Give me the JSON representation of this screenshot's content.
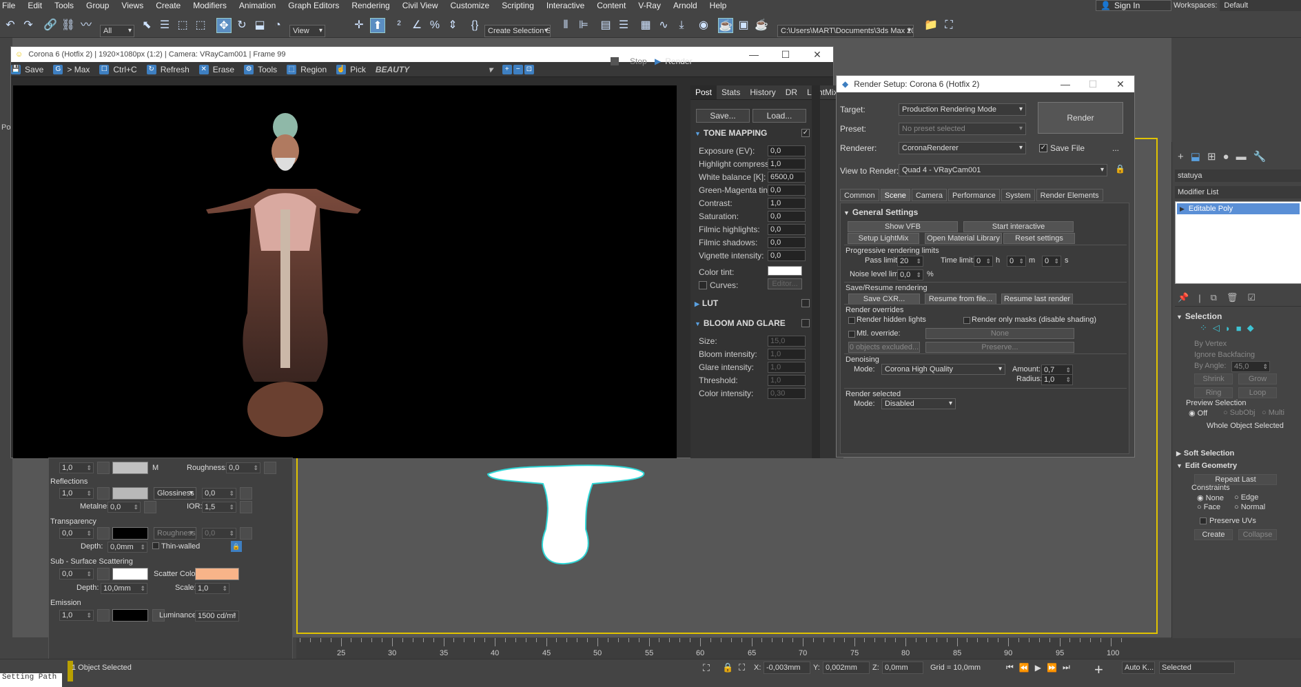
{
  "menubar": {
    "items": [
      "File",
      "Edit",
      "Tools",
      "Group",
      "Views",
      "Create",
      "Modifiers",
      "Animation",
      "Graph Editors",
      "Rendering",
      "Civil View",
      "Customize",
      "Scripting",
      "Interactive",
      "Content",
      "V-Ray",
      "Arnold",
      "Help"
    ],
    "sign_in": "Sign In",
    "workspaces_label": "Workspaces:",
    "workspaces_value": "Default"
  },
  "toolbar": {
    "filter_value": "All",
    "ref_coord_value": "View",
    "selection_set_placeholder": "Create Selection Se",
    "project_path": "C:\\Users\\MART\\Documents\\3ds Max 2021"
  },
  "vfb": {
    "title": "Corona 6 (Hotfix 2) | 1920×1080px (1:2) | Camera: VRayCam001 | Frame 99",
    "stop_label": "Stop",
    "render_label": "Render",
    "toolbar": [
      "Save",
      "> Max",
      "Ctrl+C",
      "Refresh",
      "Erase",
      "Tools",
      "Region",
      "Pick"
    ],
    "channel": "BEAUTY",
    "tabs": [
      "Post",
      "Stats",
      "History",
      "DR",
      "LightMix"
    ],
    "save_btn": "Save...",
    "load_btn": "Load...",
    "tone_mapping": {
      "title": "TONE MAPPING",
      "rows": [
        {
          "label": "Exposure (EV):",
          "value": "0,0"
        },
        {
          "label": "Highlight compress:",
          "value": "1,0"
        },
        {
          "label": "White balance [K]:",
          "value": "6500,0"
        },
        {
          "label": "Green-Magenta tint:",
          "value": "0,0"
        },
        {
          "label": "Contrast:",
          "value": "1,0"
        },
        {
          "label": "Saturation:",
          "value": "0,0"
        },
        {
          "label": "Filmic highlights:",
          "value": "0,0"
        },
        {
          "label": "Filmic shadows:",
          "value": "0,0"
        },
        {
          "label": "Vignette intensity:",
          "value": "0,0"
        }
      ],
      "color_tint": "Color tint:",
      "curves": "Curves:",
      "editor": "Editor..."
    },
    "lut_title": "LUT",
    "bloom": {
      "title": "BLOOM AND GLARE",
      "rows": [
        {
          "label": "Size:",
          "value": "15,0"
        },
        {
          "label": "Bloom intensity:",
          "value": "1,0"
        },
        {
          "label": "Glare intensity:",
          "value": "1,0"
        },
        {
          "label": "Threshold:",
          "value": "1,0"
        },
        {
          "label": "Color intensity:",
          "value": "0,30"
        }
      ]
    }
  },
  "render_setup": {
    "title": "Render Setup: Corona 6 (Hotfix 2)",
    "target_label": "Target:",
    "target_value": "Production Rendering Mode",
    "preset_label": "Preset:",
    "preset_value": "No preset selected",
    "renderer_label": "Renderer:",
    "renderer_value": "CoronaRenderer",
    "save_file": "Save File",
    "view_label": "View to Render:",
    "view_value": "Quad 4 - VRayCam001",
    "render_btn": "Render",
    "more": "...",
    "tabs": [
      "Common",
      "Scene",
      "Camera",
      "Performance",
      "System",
      "Render Elements"
    ],
    "general_settings": "General Settings",
    "buttons1": [
      "Show VFB",
      "Start interactive"
    ],
    "buttons2": [
      "Setup LightMix",
      "Open Material Library",
      "Reset settings"
    ],
    "prog_limits": "Progressive rendering limits",
    "pass_limit_label": "Pass limit:",
    "pass_limit": "20",
    "time_limit_label": "Time limit:",
    "time_h": "0",
    "time_m": "0",
    "time_s": "0",
    "h": "h",
    "m": "m",
    "s": "s",
    "noise_label": "Noise level limit:",
    "noise_value": "0,0",
    "percent": "%",
    "save_resume": "Save/Resume rendering",
    "save_cxr": "Save CXR...",
    "resume_file": "Resume from file...",
    "resume_last": "Resume last render",
    "render_overrides": "Render overrides",
    "render_hidden": "Render hidden lights",
    "render_masks": "Render only masks (disable shading)",
    "mtl_override": "Mtl. override:",
    "none": "None",
    "objects_excluded": "0 objects excluded...",
    "preserve": "Preserve...",
    "denoising": "Denoising",
    "mode_label": "Mode:",
    "denoise_mode": "Corona High Quality",
    "amount_label": "Amount:",
    "amount": "0,7",
    "radius_label": "Radius:",
    "radius": "1,0",
    "render_selected": "Render selected",
    "rsel_mode_label": "Mode:",
    "rsel_mode": "Disabled"
  },
  "material": {
    "row1_value": "1,0",
    "m_label": "M",
    "roughness_label": "Roughness:",
    "roughness": "0,0",
    "reflections": "Reflections",
    "refl_value": "1,0",
    "glossiness": "Glossiness",
    "gloss_value": "0,0",
    "metalness_label": "Metalness:",
    "metalness": "0,0",
    "ior_label": "IOR:",
    "ior": "1,5",
    "transparency": "Transparency",
    "trans_value": "0,0",
    "trans_rough_label": "Roughness",
    "trans_rough": "0,0",
    "depth_label": "Depth:",
    "depth": "0,0mm",
    "thin_walled": "Thin-walled",
    "sss": "Sub - Surface Scattering",
    "sss_value": "0,0",
    "scatter_label": "Scatter Color:",
    "sss_depth_label": "Depth:",
    "sss_depth": "10,0mm",
    "scale_label": "Scale:",
    "scale": "1,0",
    "emission": "Emission",
    "em_value": "1,0",
    "luminance_label": "Luminance:",
    "luminance": "1500 cd/m²"
  },
  "command_panel": {
    "object_name": "statuya",
    "modifier_list": "Modifier List",
    "stack_item": "Editable Poly",
    "selection": "Selection",
    "by_vertex": "By Vertex",
    "ignore_backfacing": "Ignore Backfacing",
    "by_angle": "By Angle:",
    "angle": "45,0",
    "shrink": "Shrink",
    "grow": "Grow",
    "ring": "Ring",
    "loop": "Loop",
    "preview_selection": "Preview Selection",
    "off": "Off",
    "subobj": "SubObj",
    "multi": "Multi",
    "whole_object": "Whole Object Selected",
    "soft_selection": "Soft Selection",
    "edit_geometry": "Edit Geometry",
    "repeat_last": "Repeat Last",
    "constraints": "Constraints",
    "c_none": "None",
    "c_edge": "Edge",
    "c_face": "Face",
    "c_normal": "Normal",
    "preserve_uvs": "Preserve UVs",
    "create": "Create",
    "collapse": "Collapse"
  },
  "timeline": {
    "labels": [
      "25",
      "30",
      "35",
      "40",
      "45",
      "50",
      "55",
      "60",
      "65",
      "70",
      "75",
      "80",
      "85",
      "90",
      "95",
      "100"
    ],
    "left_value": "0"
  },
  "status": {
    "selected": "1 Object Selected",
    "x_label": "X:",
    "x": "-0,003mm",
    "y_label": "Y:",
    "y": "0,002mm",
    "z_label": "Z:",
    "z": "0,0mm",
    "grid": "Grid = 10,0mm",
    "auto_key": "Auto K...",
    "key_mode": "Selected",
    "prompt": "Setting Path"
  },
  "left_labels": {
    "po": "Po"
  },
  "colors": {
    "accent": "#5b8ec2",
    "scatter": "#f8b489",
    "selected_item": "#5a8fd6"
  }
}
